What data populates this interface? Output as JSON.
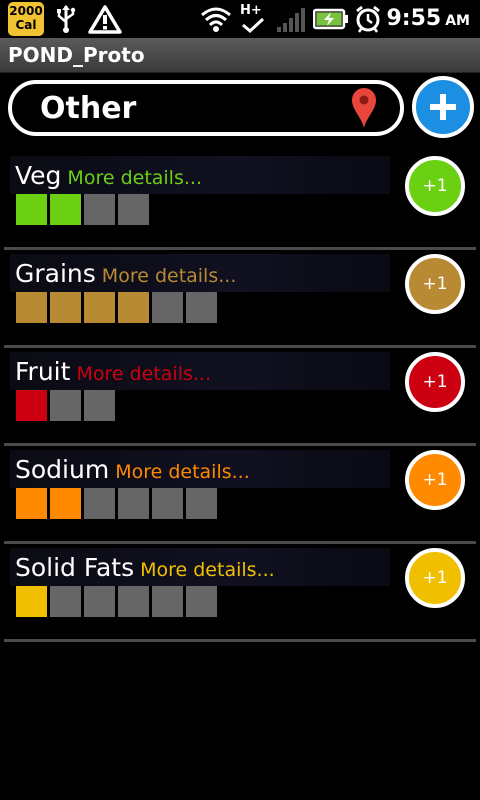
{
  "status_bar": {
    "badge_top": "2000",
    "badge_bottom": "Cal",
    "icons": [
      "usb-icon",
      "warning-icon",
      "wifi-icon",
      "hplus-data-icon",
      "signal-icon",
      "battery-charging-icon",
      "alarm-icon"
    ],
    "network_label": "H+",
    "time": "9:55",
    "ampm": "AM"
  },
  "app": {
    "title": "POND_Proto"
  },
  "location": {
    "value": "Other"
  },
  "categories": [
    {
      "name": "Veg",
      "details": "More details...",
      "color": "#6bcf12",
      "filled": 2,
      "total": 4,
      "button": "+1"
    },
    {
      "name": "Grains",
      "details": "More details...",
      "color": "#b88a33",
      "filled": 4,
      "total": 6,
      "button": "+1"
    },
    {
      "name": "Fruit",
      "details": "More details...",
      "color": "#cc0011",
      "filled": 1,
      "total": 3,
      "button": "+1"
    },
    {
      "name": "Sodium",
      "details": "More details...",
      "color": "#ff8a00",
      "filled": 2,
      "total": 6,
      "button": "+1"
    },
    {
      "name": "Solid Fats",
      "details": "More details...",
      "color": "#f0c000",
      "filled": 1,
      "total": 6,
      "button": "+1"
    }
  ]
}
